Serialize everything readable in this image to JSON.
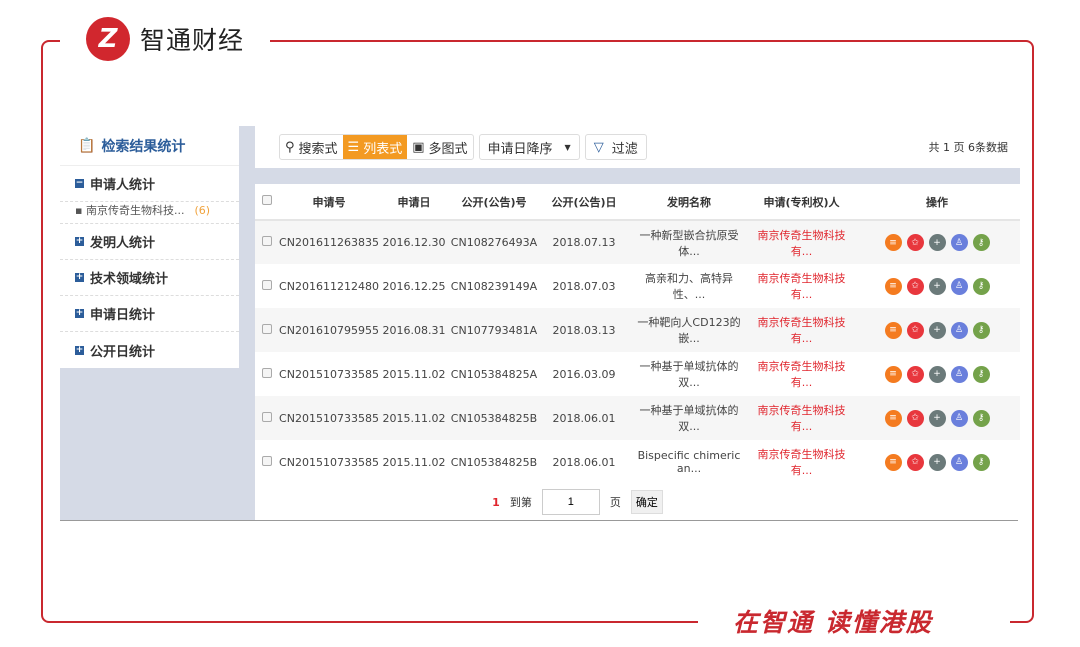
{
  "brand": {
    "name": "智通财经",
    "mark": "Z",
    "slogan": "在智通 读懂港股"
  },
  "sidebar": {
    "title": "检索结果统计",
    "sections": [
      {
        "label": "申请人统计",
        "expanded": true,
        "items": [
          {
            "label": "南京传奇生物科技...",
            "count": "(6)"
          }
        ]
      },
      {
        "label": "发明人统计"
      },
      {
        "label": "技术领域统计"
      },
      {
        "label": "申请日统计"
      },
      {
        "label": "公开日统计"
      }
    ]
  },
  "toolbar": {
    "views": [
      "搜索式",
      "列表式",
      "多图式"
    ],
    "active_view": "列表式",
    "sort": "申请日降序",
    "filter": "过滤",
    "count": "共 1 页 6条数据"
  },
  "table": {
    "headers": [
      "申请号",
      "申请日",
      "公开(公告)号",
      "公开(公告)日",
      "发明名称",
      "申请(专利权)人",
      "操作"
    ],
    "rows": [
      [
        "CN201611263835",
        "2016.12.30",
        "CN108276493A",
        "2018.07.13",
        "一种新型嵌合抗原受体...",
        "南京传奇生物科技有..."
      ],
      [
        "CN201611212480",
        "2016.12.25",
        "CN108239149A",
        "2018.07.03",
        "高亲和力、高特异性、...",
        "南京传奇生物科技有..."
      ],
      [
        "CN201610795955",
        "2016.08.31",
        "CN107793481A",
        "2018.03.13",
        "一种靶向人CD123的嵌...",
        "南京传奇生物科技有..."
      ],
      [
        "CN201510733585",
        "2015.11.02",
        "CN105384825A",
        "2016.03.09",
        "一种基于单域抗体的双...",
        "南京传奇生物科技有..."
      ],
      [
        "CN201510733585",
        "2015.11.02",
        "CN105384825B",
        "2018.06.01",
        "一种基于单域抗体的双...",
        "南京传奇生物科技有..."
      ],
      [
        "CN201510733585",
        "2015.11.02",
        "CN105384825B",
        "2018.06.01",
        "Bispecific chimeric an...",
        "南京传奇生物科技有..."
      ]
    ],
    "ops": [
      {
        "icon": "list-icon",
        "glyph": "≡",
        "color": "#f47b20"
      },
      {
        "icon": "star-icon",
        "glyph": "✩",
        "color": "#e8373d"
      },
      {
        "icon": "plus-icon",
        "glyph": "+",
        "color": "#6b7a7a"
      },
      {
        "icon": "user-icon",
        "glyph": "♙",
        "color": "#6a7fdc"
      },
      {
        "icon": "key-icon",
        "glyph": "⚷",
        "color": "#74a24a"
      }
    ]
  },
  "pager": {
    "current": "1",
    "goto": "到第",
    "page_value": "1",
    "page": "页",
    "confirm": "确定"
  }
}
